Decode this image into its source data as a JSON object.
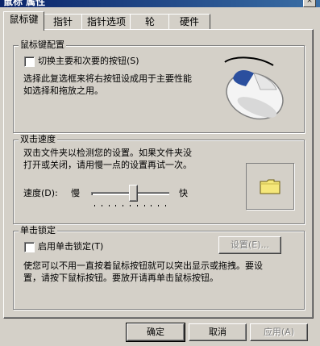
{
  "window": {
    "title": "鼠标 属性",
    "close_label": "×"
  },
  "tabs": [
    {
      "label": "鼠标键",
      "active": true
    },
    {
      "label": "指针",
      "active": false
    },
    {
      "label": "指针选项",
      "active": false
    },
    {
      "label": "轮",
      "active": false
    },
    {
      "label": "硬件",
      "active": false
    }
  ],
  "button_config": {
    "legend": "鼠标键配置",
    "checkbox_label": "切换主要和次要的按钮(S)",
    "checked": false,
    "description_line1": "选择此复选框来将右按钮设成用于主要性能",
    "description_line2": "如选择和拖放之用。",
    "image_icon": "mouse-illustration"
  },
  "double_click": {
    "legend": "双击速度",
    "description_line1": "双击文件夹以检测您的设置。如果文件夹没",
    "description_line2": "打开或关闭，请用慢一点的设置再试一次。",
    "speed_label": "速度(D):",
    "slow_label": "慢",
    "fast_label": "快",
    "speed_level": 0.55,
    "test_icon": "folder-icon"
  },
  "click_lock": {
    "legend": "单击锁定",
    "checkbox_label": "启用单击锁定(T)",
    "checked": false,
    "settings_button": "设置(E)...",
    "description_line1": "使您可以不用一直按着鼠标按钮就可以突出显示或拖拽。要设",
    "description_line2": "置，请按下鼠标按钮。要放开请再单击鼠标按钮。"
  },
  "footer": {
    "ok": "确定",
    "cancel": "取消",
    "apply": "应用(A)"
  },
  "colors": {
    "face": "#d4d0c8",
    "folder": "#f5e77a",
    "mouse_accent": "#2b4f9e"
  }
}
